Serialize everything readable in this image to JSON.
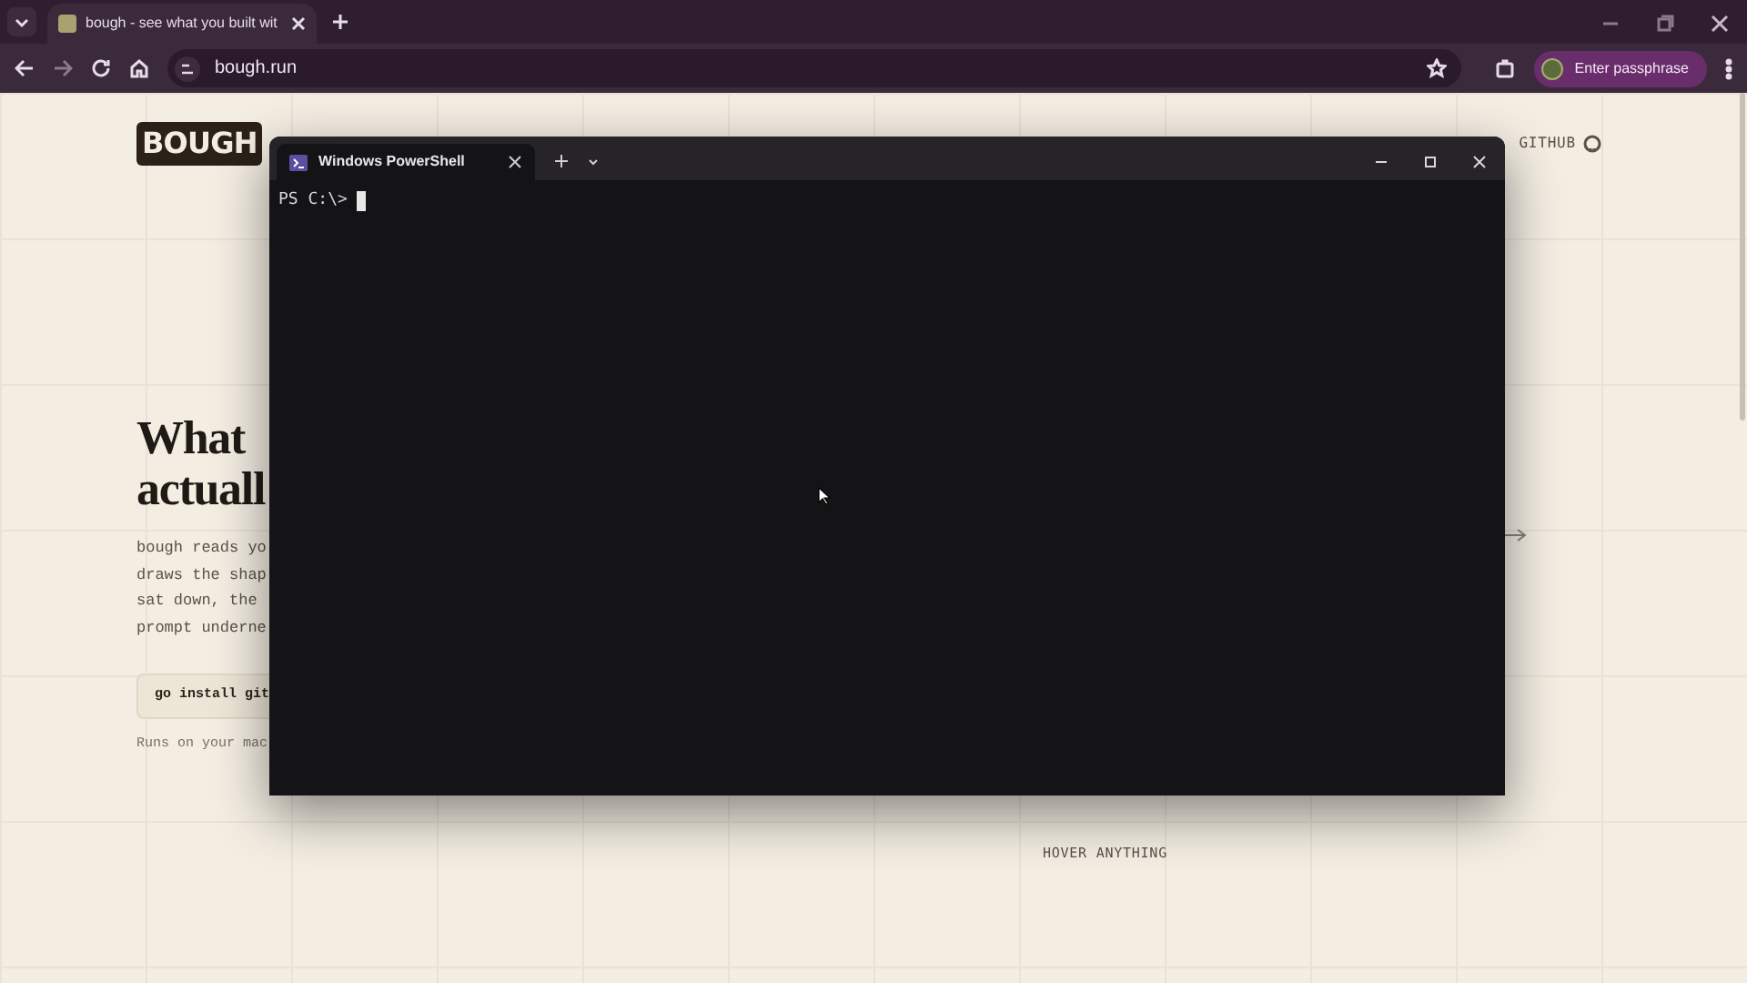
{
  "browser": {
    "tabs": [
      {
        "title": "bough - see what you built wit",
        "selected": true
      }
    ],
    "address": "bough.run",
    "profile_button": "Enter passphrase"
  },
  "page": {
    "logo": "BOUGH",
    "nav_link": "GITHUB",
    "heading_lines": [
      "What",
      "actuall"
    ],
    "intro_lines": [
      "bough reads yo",
      "draws the shap",
      "sat down, the",
      "prompt underne"
    ],
    "install_command": "go install git",
    "note": "Runs on your mac",
    "hint": "HOVER ANYTHING"
  },
  "terminal": {
    "tabs": [
      {
        "title": "Windows PowerShell",
        "selected": true
      }
    ],
    "prompt": "PS C:\\>"
  }
}
